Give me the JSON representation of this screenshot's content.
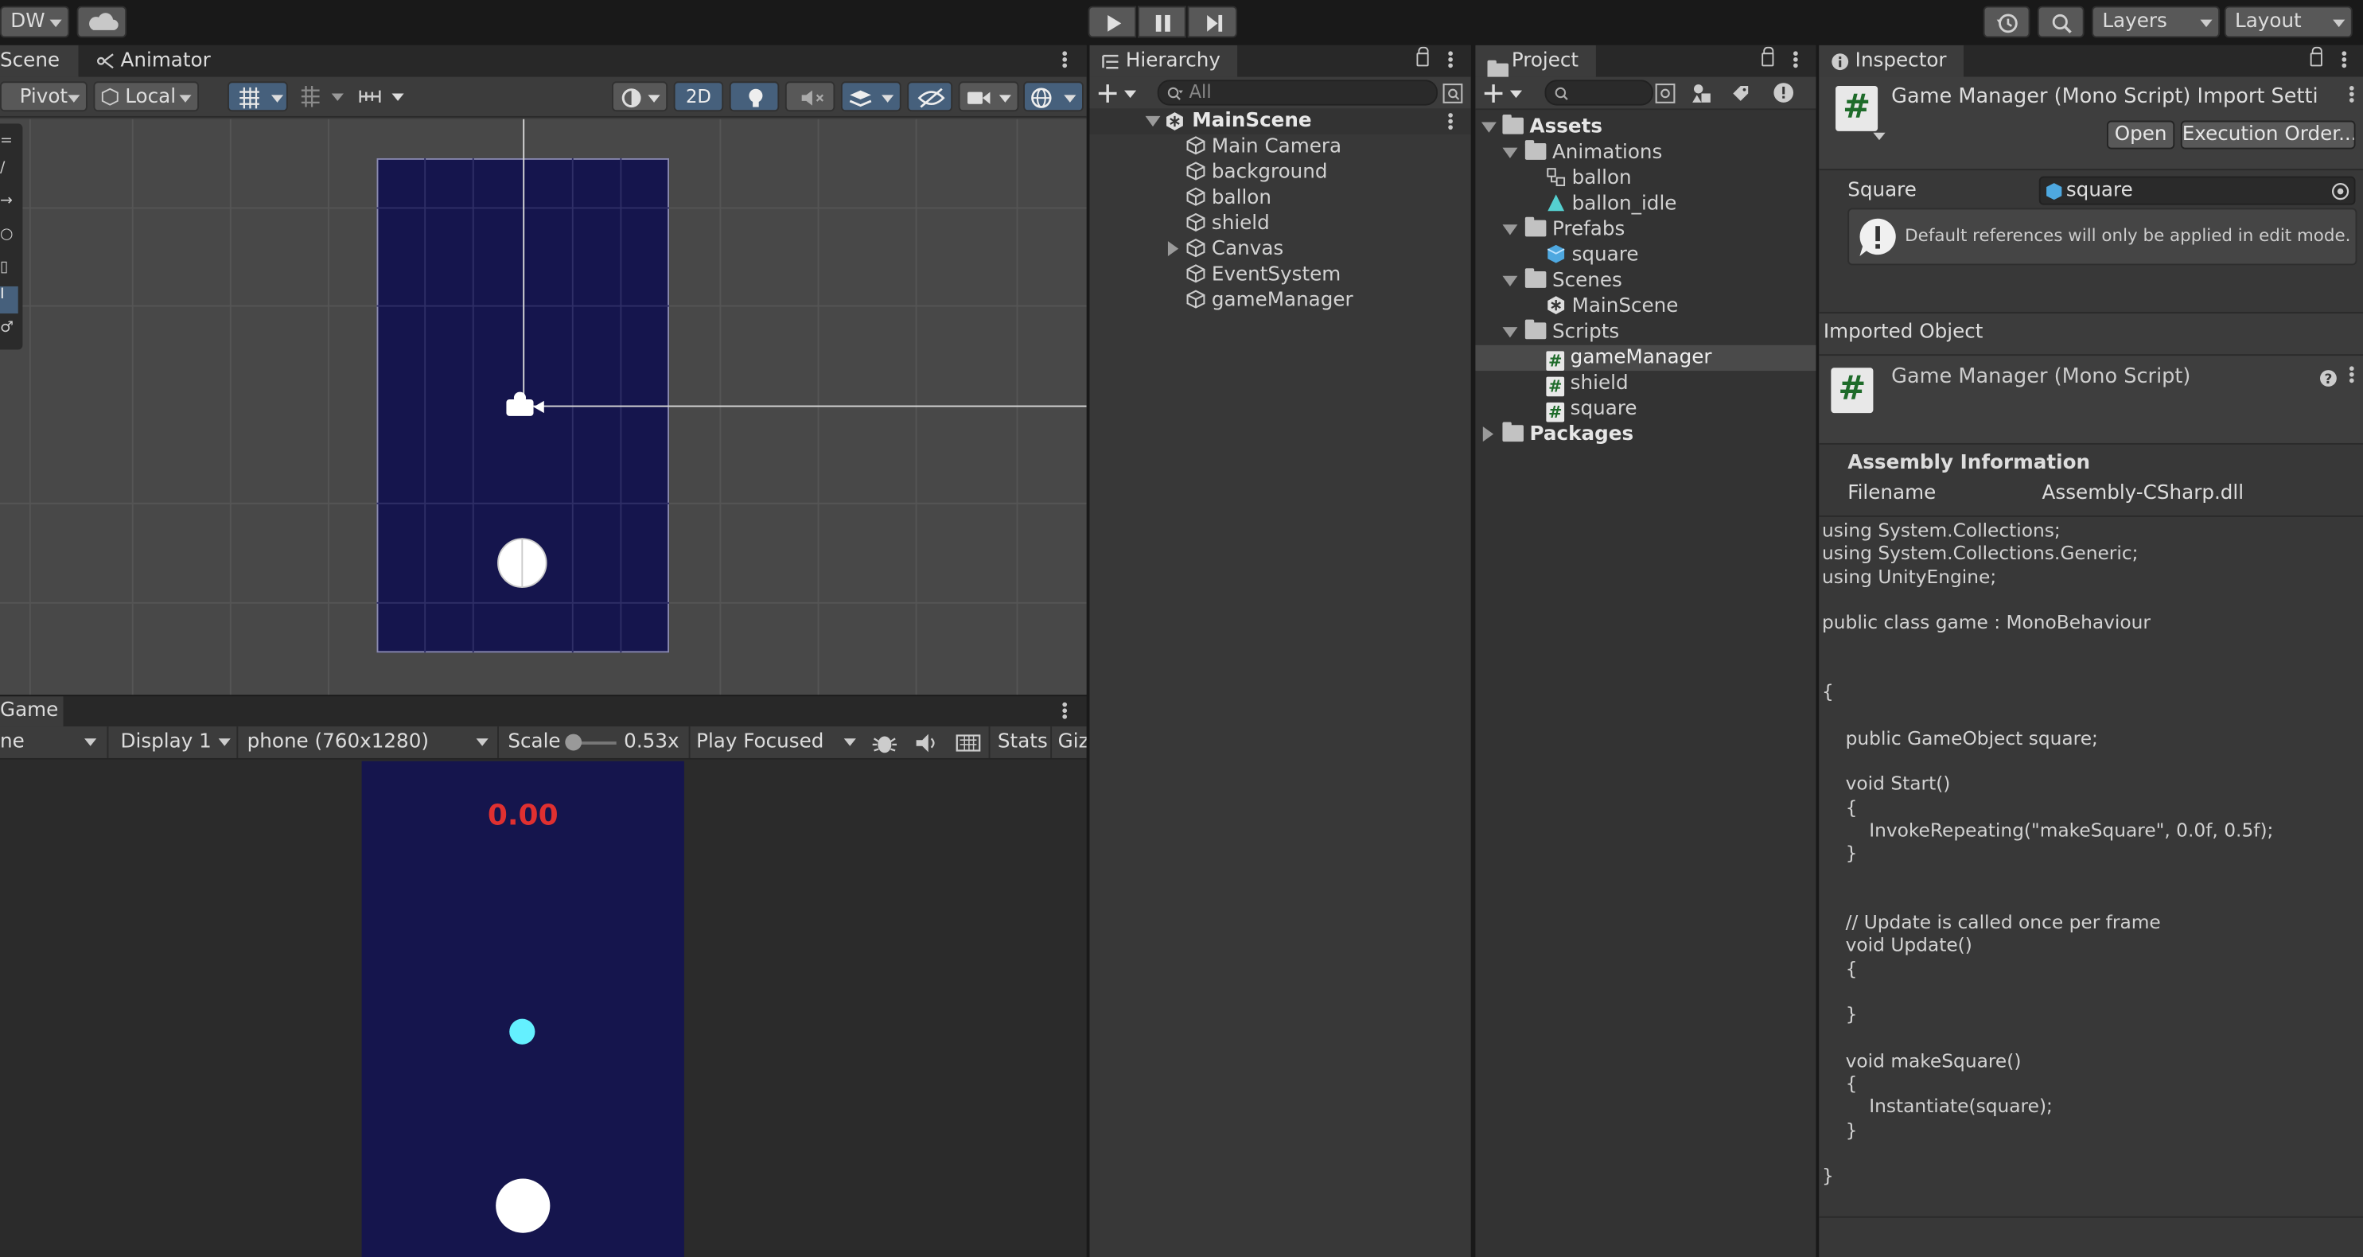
{
  "toolbar": {
    "account_label": "DW",
    "layers_label": "Layers",
    "layout_label": "Layout",
    "icons": [
      "cloud-icon",
      "play-icon",
      "pause-icon",
      "step-icon",
      "history-icon",
      "search-icon"
    ]
  },
  "scene_panel": {
    "tabs": [
      {
        "label": "Scene"
      },
      {
        "label": "Animator"
      }
    ],
    "pivot_label": "Pivot",
    "local_label": "Local",
    "mode_2d_label": "2D",
    "colors": {
      "background": "#484848",
      "camera_rect": "#15154d"
    }
  },
  "game_panel": {
    "tab_label": "Game",
    "view_dropdown": "ne",
    "display_label": "Display 1",
    "resolution_label": "phone (760x1280)",
    "scale_label": "Scale",
    "scale_value": "0.53x",
    "play_mode_label": "Play Focused",
    "stats_label": "Stats",
    "gizmos_label": "Giz",
    "score_text": "0.00",
    "colors": {
      "game_bg": "#15154d",
      "score": "#e03030",
      "shield": "#64f0ff"
    }
  },
  "hierarchy": {
    "tab_label": "Hierarchy",
    "search_placeholder": "All",
    "scene_name": "MainScene",
    "items": [
      {
        "label": "Main Camera"
      },
      {
        "label": "background"
      },
      {
        "label": "ballon"
      },
      {
        "label": "shield"
      },
      {
        "label": "Canvas",
        "has_children": true
      },
      {
        "label": "EventSystem"
      },
      {
        "label": "gameManager"
      }
    ]
  },
  "project": {
    "tab_label": "Project",
    "root_label": "Assets",
    "folders": [
      {
        "label": "Animations",
        "items": [
          {
            "label": "ballon",
            "icon": "animator-controller-icon"
          },
          {
            "label": "ballon_idle",
            "icon": "animation-clip-icon"
          }
        ]
      },
      {
        "label": "Prefabs",
        "items": [
          {
            "label": "square",
            "icon": "prefab-icon"
          }
        ]
      },
      {
        "label": "Scenes",
        "items": [
          {
            "label": "MainScene",
            "icon": "scene-icon"
          }
        ]
      },
      {
        "label": "Scripts",
        "items": [
          {
            "label": "gameManager",
            "icon": "script-icon",
            "selected": true
          },
          {
            "label": "shield",
            "icon": "script-icon"
          },
          {
            "label": "square",
            "icon": "script-icon"
          }
        ]
      }
    ],
    "packages_label": "Packages"
  },
  "inspector": {
    "tab_label": "Inspector",
    "title": "Game Manager (Mono Script) Import Setti",
    "open_button": "Open",
    "execution_order_button": "Execution Order...",
    "field_label": "Square",
    "field_value": "square",
    "info_message": "Default references will only be applied in edit mode.",
    "imported_object_label": "Imported Object",
    "imported_title": "Game Manager (Mono Script)",
    "assembly_header": "Assembly Information",
    "filename_label": "Filename",
    "filename_value": "Assembly-CSharp.dll",
    "code": "using System.Collections;\nusing System.Collections.Generic;\nusing UnityEngine;\n\npublic class game : MonoBehaviour\n\n\n{\n\n    public GameObject square;\n\n    void Start()\n    {\n        InvokeRepeating(\"makeSquare\", 0.0f, 0.5f);\n    }\n\n\n    // Update is called once per frame\n    void Update()\n    {\n\n    }\n\n    void makeSquare()\n    {\n        Instantiate(square);\n    }\n\n}"
  }
}
